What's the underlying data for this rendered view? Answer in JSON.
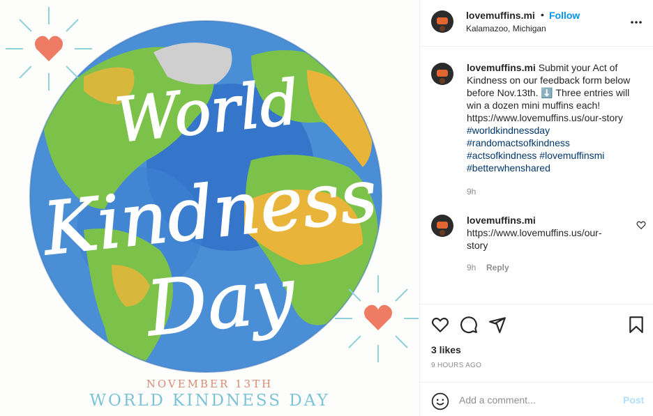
{
  "post_image": {
    "title_lines": [
      "World",
      "Kindness",
      "Day"
    ],
    "date_line": "NOVEMBER 13TH",
    "sub_line": "WORLD KINDNESS DAY",
    "colors": {
      "ocean": "#4a8fd6",
      "land": "#7cc24a",
      "desert": "#e8b53a",
      "heart": "#ee7b64",
      "ray": "#8fd1d8"
    }
  },
  "header": {
    "username": "lovemuffins.mi",
    "dot": "•",
    "follow_label": "Follow",
    "location": "Kalamazoo, Michigan",
    "more_icon": "more-horizontal-icon"
  },
  "caption": {
    "username": "lovemuffins.mi",
    "text_before": "Submit your Act of Kindness on our feedback form below before Nov.13th. ",
    "emoji": "⬇️",
    "text_after": " Three entries will win a dozen mini muffins each!",
    "url": "https://www.lovemuffins.us/our-story",
    "hashtags": [
      "#worldkindnessday",
      "#randomactsofkindness",
      "#actsofkindness",
      "#lovemuffinsmi",
      "#betterwhenshared"
    ],
    "time": "9h"
  },
  "comment": {
    "username": "lovemuffins.mi",
    "text": "https://www.lovemuffins.us/our-story",
    "time": "9h",
    "reply_label": "Reply"
  },
  "actions": {
    "icons": [
      "heart-icon",
      "comment-icon",
      "share-icon",
      "bookmark-icon"
    ],
    "likes": "3 likes",
    "posted_ago": "9 HOURS AGO"
  },
  "comment_bar": {
    "placeholder": "Add a comment...",
    "post_label": "Post",
    "accent": "#0095f6",
    "post_disabled_color": "#b2dffc"
  }
}
